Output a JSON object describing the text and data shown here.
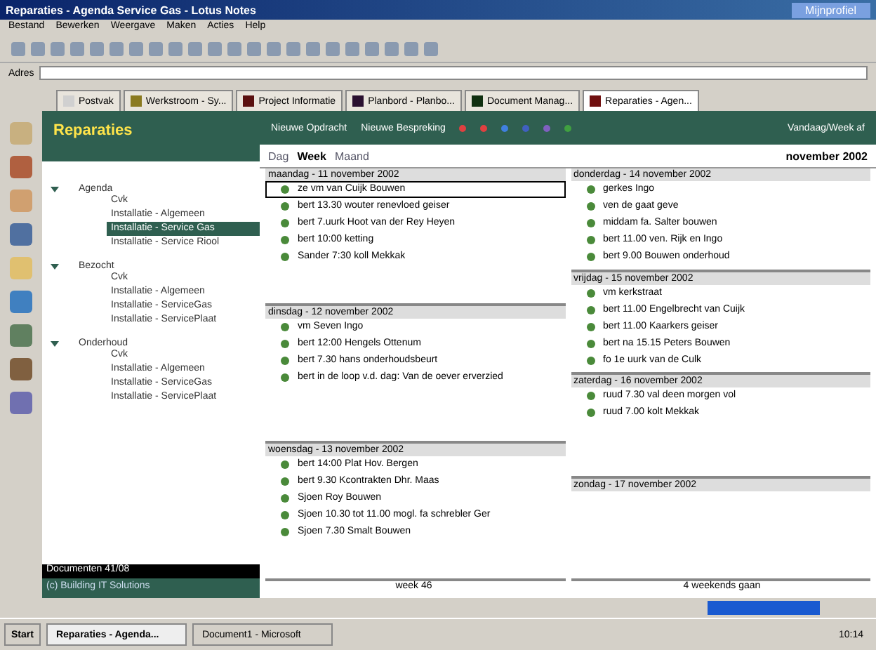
{
  "window": {
    "title": "Reparaties - Agenda Service Gas - Lotus Notes",
    "user": "Mijnprofiel"
  },
  "menu": [
    "Bestand",
    "Bewerken",
    "Weergave",
    "Maken",
    "Acties",
    "Help"
  ],
  "address": {
    "label": "Adres"
  },
  "tabs": [
    {
      "label": "Postvak",
      "selected": false,
      "color": "#d0d0d0"
    },
    {
      "label": "Werkstroom - Sy...",
      "selected": false,
      "color": "#8a7a20"
    },
    {
      "label": "Project Informatie",
      "selected": false,
      "color": "#5a1010"
    },
    {
      "label": "Planbord - Planbo...",
      "selected": false,
      "color": "#2a1030"
    },
    {
      "label": "Document Manag...",
      "selected": false,
      "color": "#103010"
    },
    {
      "label": "Reparaties - Agen...",
      "selected": true,
      "color": "#701010"
    }
  ],
  "nav": {
    "title": "Reparaties",
    "tree": [
      {
        "label": "Agenda",
        "expanded": true,
        "children": [
          {
            "label": "Cvk",
            "selected": false
          },
          {
            "label": "Installatie - Algemeen",
            "selected": false
          },
          {
            "label": "Installatie - Service Gas",
            "selected": true
          },
          {
            "label": "Installatie - Service Riool",
            "selected": false
          }
        ]
      },
      {
        "label": "Bezocht",
        "expanded": true,
        "children": [
          {
            "label": "Cvk",
            "selected": false
          },
          {
            "label": "Installatie - Algemeen",
            "selected": false
          },
          {
            "label": "Installatie - ServiceGas",
            "selected": false
          },
          {
            "label": "Installatie - ServicePlaat",
            "selected": false
          }
        ]
      },
      {
        "label": "Onderhoud",
        "expanded": true,
        "children": [
          {
            "label": "Cvk",
            "selected": false
          },
          {
            "label": "Installatie - Algemeen",
            "selected": false
          },
          {
            "label": "Installatie - ServiceGas",
            "selected": false
          },
          {
            "label": "Installatie - ServicePlaat",
            "selected": false
          }
        ]
      }
    ],
    "status": "Documenten 41/08",
    "footer": "(c) Building IT Solutions"
  },
  "toolbar": {
    "buttons": [
      "Nieuwe Opdracht",
      "Nieuwe Bespreking"
    ],
    "right": "Vandaag/Week af"
  },
  "views": [
    {
      "label": "Dag",
      "selected": false
    },
    {
      "label": "Week",
      "selected": true
    },
    {
      "label": "Maand",
      "selected": false
    }
  ],
  "month": "november 2002",
  "columns": [
    [
      {
        "day": "maandag - 11 november 2002",
        "entries": [
          {
            "who": "ze",
            "time": "vm",
            "text": "van Cuijk Bouwen",
            "selected": true
          },
          {
            "who": "bert",
            "time": "13.30",
            "text": "wouter renevloed geiser",
            "selected": false
          },
          {
            "who": "bert",
            "time": "7.uurk",
            "text": "Hoot van der Rey Heyen",
            "selected": false
          },
          {
            "who": "bert",
            "time": "10:00",
            "text": "ketting",
            "selected": false
          },
          {
            "who": "Sander",
            "time": "7:30",
            "text": "koll Mekkak",
            "selected": false
          }
        ]
      },
      {
        "day": "dinsdag - 12 november 2002",
        "entries": [
          {
            "time": "vm",
            "text": "Seven Ingo",
            "selected": false
          },
          {
            "who": "bert",
            "time": "12:00",
            "text": "Hengels Ottenum",
            "selected": false
          },
          {
            "who": "bert",
            "time": "7.30",
            "text": "hans onderhoudsbeurt",
            "selected": false
          },
          {
            "who": "bert",
            "text": "in de loop v.d. dag: Van de oever erverzied",
            "selected": false
          }
        ]
      },
      {
        "day": "woensdag - 13 november 2002",
        "entries": [
          {
            "who": "bert",
            "time": "14:00",
            "text": "Plat Hov. Bergen",
            "selected": false
          },
          {
            "who": "bert",
            "time": "9.30",
            "text": "Kcontrakten   Dhr. Maas",
            "selected": false
          },
          {
            "who": "Sjoen",
            "text": "Roy Bouwen",
            "selected": false
          },
          {
            "who": "Sjoen",
            "time": "10.30 tot 11.00 mogl.",
            "text": "fa schrebler Ger",
            "selected": false
          },
          {
            "who": "Sjoen",
            "time": "7.30",
            "text": "Smalt Bouwen",
            "selected": false
          }
        ]
      }
    ],
    [
      {
        "day": "donderdag - 14 november 2002",
        "entries": [
          {
            "text": "gerkes Ingo",
            "selected": false
          },
          {
            "text": "ven de gaat geve",
            "selected": false
          },
          {
            "time": "middam",
            "text": "fa. Salter bouwen",
            "selected": false
          },
          {
            "who": "bert",
            "time": "11.00",
            "text": "ven. Rijk en Ingo",
            "selected": false
          },
          {
            "who": "bert",
            "time": "9.00",
            "text": "Bouwen onderhoud",
            "selected": false
          }
        ]
      },
      {
        "day": "vrijdag - 15 november 2002",
        "entries": [
          {
            "time": "vm",
            "text": "kerkstraat",
            "selected": false
          },
          {
            "who": "bert",
            "time": "11.00",
            "text": "Engelbrecht van Cuijk",
            "selected": false
          },
          {
            "who": "bert",
            "time": "11.00",
            "text": "Kaarkers geiser",
            "selected": false
          },
          {
            "who": "bert",
            "time": "na 15.15",
            "text": "Peters Bouwen",
            "selected": false
          },
          {
            "who": "fo",
            "time": "1e uurk",
            "text": "van de Culk",
            "selected": false
          }
        ]
      },
      {
        "day": "zaterdag - 16 november 2002",
        "entries": [
          {
            "who": "ruud",
            "time": "7.30 val deen",
            "text": "morgen vol",
            "selected": false
          },
          {
            "who": "ruud",
            "time": "7.00",
            "text": "kolt Mekkak",
            "selected": false
          }
        ]
      },
      {
        "day": "zondag - 17 november 2002"
      }
    ]
  ],
  "footers": [
    "week 46",
    "4 weekends gaan"
  ],
  "taskbar": {
    "start": "Start",
    "windows": [
      {
        "label": "Reparaties - Agenda...",
        "selected": true
      },
      {
        "label": "Document1 - Microsoft",
        "selected": false
      }
    ],
    "clock": "10:14"
  }
}
